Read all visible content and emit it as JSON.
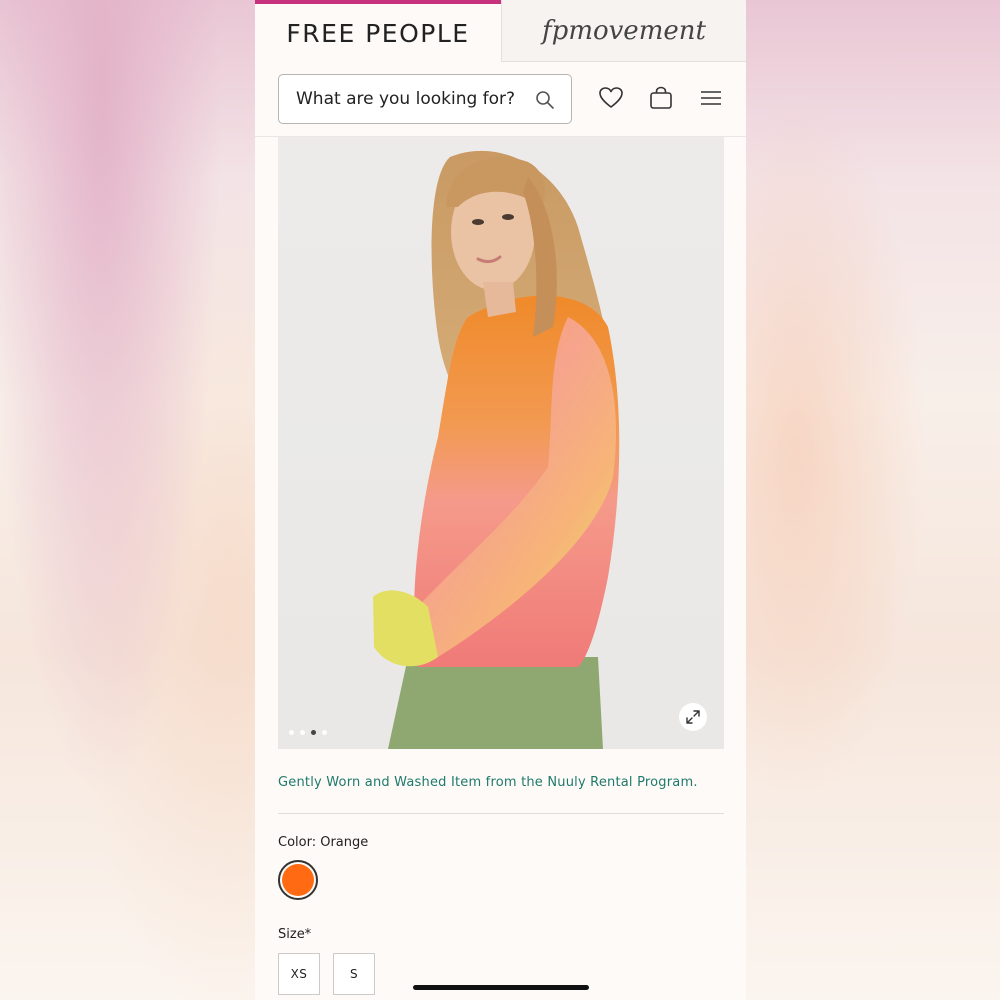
{
  "tabs": {
    "brand": "FREE PEOPLE",
    "movement": "fpmovement"
  },
  "search": {
    "placeholder": "What are you looking for?"
  },
  "icons": {
    "search": "search-icon",
    "wishlist": "heart-icon",
    "bag": "shopping-bag-icon",
    "menu": "hamburger-menu-icon",
    "expand": "expand-icon"
  },
  "gallery": {
    "image_count": 4,
    "active_index": 2
  },
  "product": {
    "notice": "Gently Worn and Washed Item from the Nuuly Rental Program.",
    "color_label": "Color: Orange",
    "selected_color": "#ff6a13",
    "size_label": "Size*",
    "sizes": [
      "XS",
      "S"
    ]
  },
  "colors": {
    "accent": "#c8317e",
    "notice": "#1f7a6a"
  }
}
